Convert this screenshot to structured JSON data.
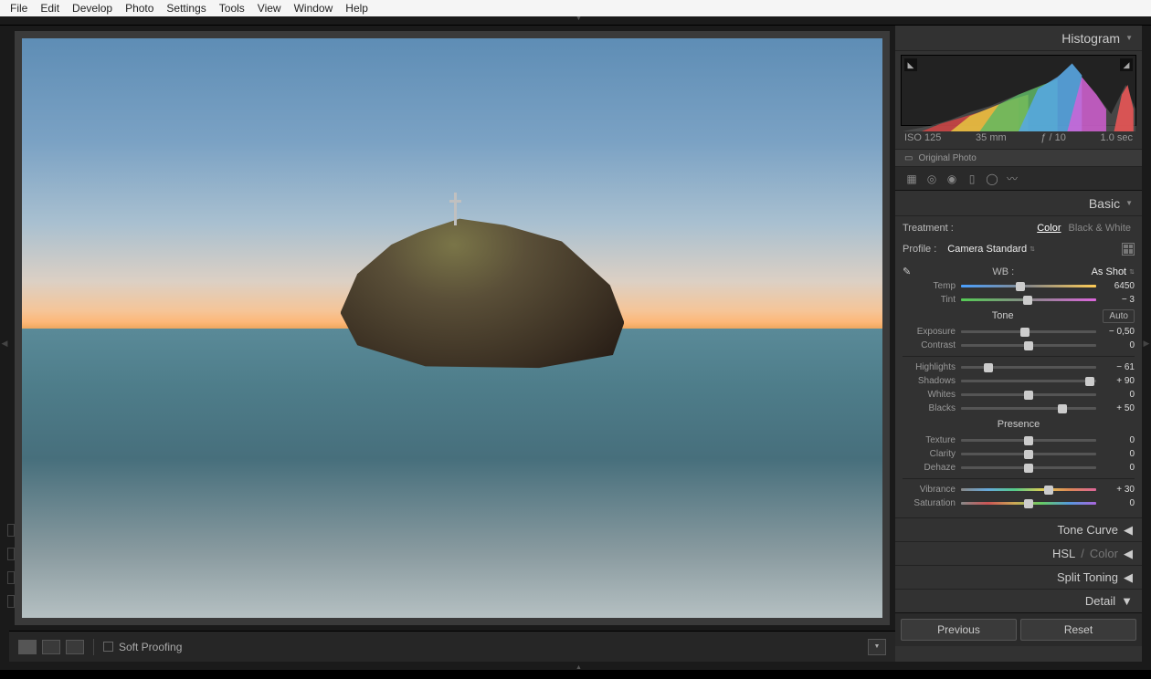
{
  "menu": {
    "items": [
      "File",
      "Edit",
      "Develop",
      "Photo",
      "Settings",
      "Tools",
      "View",
      "Window",
      "Help"
    ]
  },
  "histogram": {
    "title": "Histogram",
    "iso": "ISO 125",
    "focal": "35 mm",
    "aperture": "ƒ / 10",
    "shutter": "1.0 sec",
    "original": "Original Photo"
  },
  "basic": {
    "title": "Basic",
    "treatment_label": "Treatment :",
    "treatment_color": "Color",
    "treatment_bw": "Black & White",
    "profile_label": "Profile :",
    "profile_value": "Camera Standard",
    "wb_label": "WB :",
    "wb_value": "As Shot",
    "tone_label": "Tone",
    "auto_label": "Auto",
    "presence_label": "Presence",
    "sliders": {
      "temp": {
        "label": "Temp",
        "value": "6450",
        "pos": 44,
        "bar": "temp"
      },
      "tint": {
        "label": "Tint",
        "value": "− 3",
        "pos": 49,
        "bar": "tint"
      },
      "exposure": {
        "label": "Exposure",
        "value": "− 0,50",
        "pos": 47
      },
      "contrast": {
        "label": "Contrast",
        "value": "0",
        "pos": 50
      },
      "highlights": {
        "label": "Highlights",
        "value": "− 61",
        "pos": 20
      },
      "shadows": {
        "label": "Shadows",
        "value": "+ 90",
        "pos": 95
      },
      "whites": {
        "label": "Whites",
        "value": "0",
        "pos": 50
      },
      "blacks": {
        "label": "Blacks",
        "value": "+ 50",
        "pos": 75
      },
      "texture": {
        "label": "Texture",
        "value": "0",
        "pos": 50
      },
      "clarity": {
        "label": "Clarity",
        "value": "0",
        "pos": 50
      },
      "dehaze": {
        "label": "Dehaze",
        "value": "0",
        "pos": 50
      },
      "vibrance": {
        "label": "Vibrance",
        "value": "+ 30",
        "pos": 65,
        "bar": "vib"
      },
      "saturation": {
        "label": "Saturation",
        "value": "0",
        "pos": 50,
        "bar": "sat"
      }
    }
  },
  "panels": {
    "tone_curve": "Tone Curve",
    "hsl": "HSL",
    "hsl_sep": " / ",
    "hsl_color": "Color",
    "split": "Split Toning",
    "detail": "Detail"
  },
  "toolbar": {
    "soft_proof": "Soft Proofing"
  },
  "buttons": {
    "prev": "Previous",
    "reset": "Reset"
  }
}
